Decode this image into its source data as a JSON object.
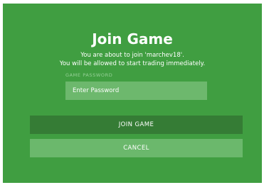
{
  "dialog": {
    "title": "Join Game",
    "subtitle_line1": "You are about to join 'marchev18'.",
    "subtitle_line2": "You will be allowed to start trading immediately.",
    "password_label": "GAME PASSWORD",
    "password_placeholder": "Enter Password",
    "password_value": "",
    "join_label": "JOIN GAME",
    "cancel_label": "CANCEL"
  },
  "colors": {
    "dialog_bg": "#409e41",
    "input_bg": "#6db86d",
    "join_bg": "#357c35",
    "cancel_bg": "#6bb86c",
    "label_color": "#97d198"
  }
}
